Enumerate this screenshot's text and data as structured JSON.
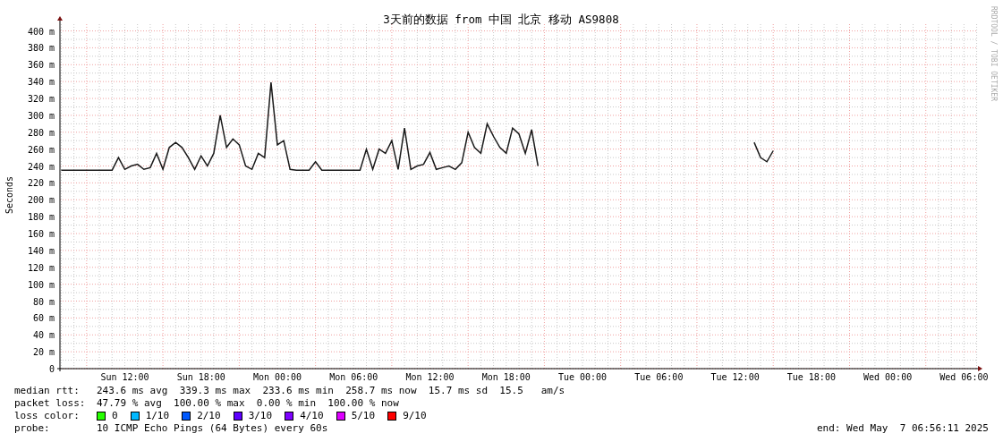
{
  "chart": {
    "chart_data": {
      "type": "line",
      "title": "3天前的数据 from 中国 北京 移动 AS9808",
      "ylabel": "Seconds",
      "categories": [
        null,
        null,
        null,
        null,
        null,
        null,
        null,
        null,
        null,
        null,
        "Sun 12:00",
        null,
        null,
        null,
        null,
        null,
        null,
        null,
        null,
        null,
        null,
        null,
        "Sun 18:00",
        null,
        null,
        null,
        null,
        null,
        null,
        null,
        null,
        null,
        null,
        null,
        "Mon 00:00",
        null,
        null,
        null,
        null,
        null,
        null,
        null,
        null,
        null,
        null,
        null,
        "Mon 06:00",
        null,
        null,
        null,
        null,
        null,
        null,
        null,
        null,
        null,
        null,
        null,
        "Mon 12:00",
        null,
        null,
        null,
        null,
        null,
        null,
        null,
        null,
        null,
        null,
        null,
        "Mon 18:00",
        null,
        null,
        null,
        null,
        null,
        null,
        null,
        null,
        null,
        null,
        null,
        "Tue 00:00",
        null,
        null,
        null,
        null,
        null,
        null,
        null,
        null,
        null,
        null,
        null,
        "Tue 06:00",
        null,
        null,
        null,
        null,
        null,
        null,
        null,
        null,
        null,
        null,
        null,
        "Tue 12:00",
        null,
        null,
        null,
        null,
        null,
        null,
        null,
        null,
        null,
        null,
        null,
        "Tue 18:00",
        null,
        null,
        null,
        null,
        null,
        null,
        null,
        null,
        null,
        null,
        null,
        "Wed 00:00",
        null,
        null,
        null,
        null,
        null,
        null,
        null,
        null,
        null,
        null,
        null,
        "Wed 06:00",
        null,
        null
      ],
      "series": [
        {
          "name": "median rtt:",
          "color": "#1a1a1a",
          "values": [
            235,
            235,
            235,
            235,
            235,
            235,
            235,
            235,
            235,
            250,
            236,
            240,
            242,
            236,
            238,
            255,
            236,
            262,
            268,
            262,
            250,
            236,
            252,
            240,
            255,
            300,
            262,
            272,
            265,
            240,
            236,
            255,
            250,
            339,
            265,
            270,
            236,
            235,
            235,
            235,
            245,
            235,
            235,
            235,
            235,
            235,
            235,
            235,
            260,
            236,
            260,
            255,
            270,
            236,
            285,
            236,
            240,
            242,
            256,
            236,
            238,
            240,
            236,
            244,
            280,
            262,
            255,
            290,
            275,
            262,
            255,
            285,
            278,
            255,
            283,
            240,
            null,
            null,
            null,
            null,
            null,
            null,
            null,
            null,
            null,
            null,
            null,
            null,
            null,
            null,
            null,
            null,
            null,
            null,
            null,
            null,
            null,
            null,
            null,
            null,
            null,
            null,
            null,
            null,
            null,
            null,
            null,
            null,
            null,
            268,
            250,
            245,
            258,
            null,
            null,
            null,
            null,
            null,
            null,
            null,
            null,
            null,
            null,
            null,
            null,
            null,
            null,
            null,
            null,
            null,
            null,
            null,
            null,
            null,
            null,
            null,
            null,
            null,
            null,
            null,
            null,
            null,
            null,
            null,
            null
          ]
        }
      ],
      "ylim": [
        0,
        408
      ],
      "grid": true,
      "yticks": [
        {
          "value": 0,
          "label": "0"
        },
        {
          "value": 20,
          "label": "20 m"
        },
        {
          "value": 40,
          "label": "40 m"
        },
        {
          "value": 60,
          "label": "60 m"
        },
        {
          "value": 80,
          "label": "80 m"
        },
        {
          "value": 100,
          "label": "100 m"
        },
        {
          "value": 120,
          "label": "120 m"
        },
        {
          "value": 140,
          "label": "140 m"
        },
        {
          "value": 160,
          "label": "160 m"
        },
        {
          "value": 180,
          "label": "180 m"
        },
        {
          "value": 200,
          "label": "200 m"
        },
        {
          "value": 220,
          "label": "220 m"
        },
        {
          "value": 240,
          "label": "240 m"
        },
        {
          "value": 260,
          "label": "260 m"
        },
        {
          "value": 280,
          "label": "280 m"
        },
        {
          "value": 300,
          "label": "300 m"
        },
        {
          "value": 320,
          "label": "320 m"
        },
        {
          "value": 340,
          "label": "340 m"
        },
        {
          "value": 360,
          "label": "360 m"
        },
        {
          "value": 380,
          "label": "380 m"
        },
        {
          "value": 400,
          "label": "400 m"
        }
      ]
    },
    "credit": "RRDTOOL / TOBI OETIKER"
  },
  "legend": {
    "median_text": "243.6 ms avg  339.3 ms max  233.6 ms min  258.7 ms now  15.7 ms sd  15.5   am/s",
    "rows": [
      {
        "label": "packet loss:",
        "text": "47.79 % avg  100.00 % max  0.00 % min  100.00 % now"
      }
    ],
    "loss_color": {
      "label": "loss color:",
      "items": [
        {
          "label": "0",
          "color": "#26ff00"
        },
        {
          "label": "1/10",
          "color": "#00b8ff"
        },
        {
          "label": "2/10",
          "color": "#0059ff"
        },
        {
          "label": "3/10",
          "color": "#5e00ff"
        },
        {
          "label": "4/10",
          "color": "#7e00ff"
        },
        {
          "label": "5/10",
          "color": "#dd00ff"
        },
        {
          "label": "9/10",
          "color": "#ff0000"
        }
      ]
    },
    "probe": {
      "label": "probe:",
      "text": "10 ICMP Echo Pings (64 Bytes) every 60s"
    },
    "end": "end: Wed May  7 06:56:11 2025"
  }
}
